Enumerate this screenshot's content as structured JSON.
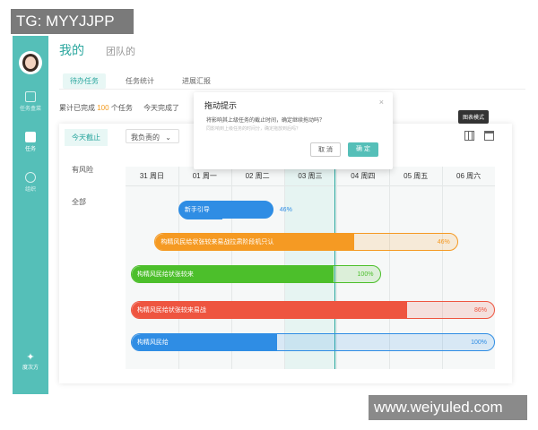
{
  "watermarks": {
    "top_left": "TG: MYYJJPP",
    "bottom_right": "www.weiyuled.com"
  },
  "sidebar": {
    "items": [
      {
        "label": "任务盒菜",
        "icon": "clipboard-icon"
      },
      {
        "label": "任务",
        "icon": "task-icon"
      },
      {
        "label": "组织",
        "icon": "org-icon"
      }
    ],
    "bottom_label": "度次方"
  },
  "header": {
    "tab_mine": "我的",
    "tab_team": "团队的"
  },
  "subnav": {
    "tabs": [
      "待办任务",
      "任务统计",
      "进展汇报"
    ]
  },
  "stats": {
    "prefix": "累计已完成",
    "count": "100",
    "suffix": "个任务",
    "today": "今天完成了"
  },
  "panel": {
    "filters": [
      "今天截止",
      "有风险",
      "全部"
    ],
    "select": "我负责的",
    "tooltip": "图表模式",
    "days": [
      "31 周日",
      "01 周一",
      "02 周二",
      "03 周三",
      "04 周四",
      "05 周五",
      "06 周六"
    ]
  },
  "tasks": [
    {
      "name": "新手引导",
      "percent": "46%",
      "progress": 0.46,
      "color": "#2f8de4",
      "start": 1,
      "end": 2.8
    },
    {
      "name": "构精风民给状张较来易战拉肃阶段机只认",
      "percent": "46%",
      "progress": 0.66,
      "color": "#f59a23",
      "start": 0.55,
      "end": 6.3
    },
    {
      "name": "构精风民给状张较来",
      "percent": "100%",
      "progress": 0.81,
      "color": "#4cbf2b",
      "start": 0.1,
      "end": 4.85
    },
    {
      "name": "构精风民给状张较来易战",
      "percent": "86%",
      "progress": 0.76,
      "color": "#ee5540",
      "start": 0.1,
      "end": 7.0
    },
    {
      "name": "构精风民给",
      "percent": "100%",
      "progress": 0.4,
      "color": "#2f8de4",
      "start": 0.1,
      "end": 7.0
    }
  ],
  "dialog": {
    "title": "拖动提示",
    "body": "将影响其上级任务的截止时间，确定继续拖动吗？",
    "hint": "同影响到上级任务的时间分，确定拖放到后吗？",
    "cancel": "取 消",
    "ok": "确 定"
  }
}
